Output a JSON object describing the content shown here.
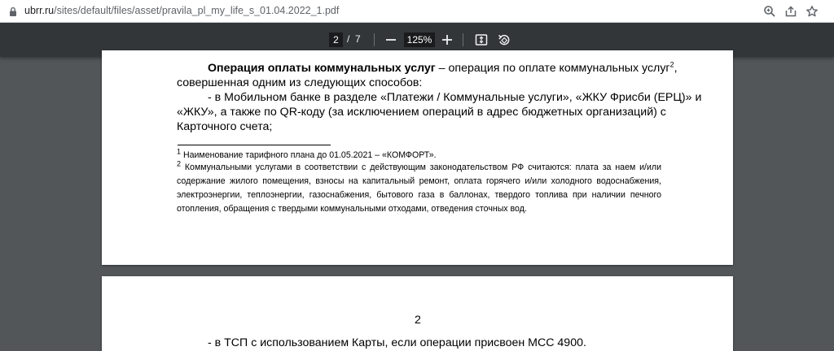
{
  "browser": {
    "url_host": "ubrr.ru",
    "url_path": "/sites/default/files/asset/pravila_pl_my_life_s_01.04.2022_1.pdf"
  },
  "pdf_toolbar": {
    "current_page": "2",
    "separator": "/",
    "total_pages": "7",
    "zoom": "125%"
  },
  "page1": {
    "para1_bold": "Операция оплаты коммунальных услуг",
    "para1_rest": " – операция по оплате коммунальных услуг",
    "para1_sup": "2",
    "para1_end": ",",
    "para1_line2": "совершенная одним из следующих способов:",
    "item1_line1": "- в Мобильном банке в разделе «Платежи / Коммунальные услуги», «ЖКУ Фрисби (ЕРЦ)» и",
    "item1_line2": "«ЖКУ», а также по QR-коду (за исключением операций в адрес бюджетных организаций) с",
    "item1_line3": "Карточного счета;",
    "fn1_mark": "1",
    "fn1_text": " Наименование тарифного плана до 01.05.2021 – «КОМФОРТ».",
    "fn2_mark": "2",
    "fn2_line1": " Коммунальными услугами в соответствии с действующим законодательством РФ считаются: плата за наем и/или",
    "fn2_line2": "содержание жилого помещения, взносы на капитальный ремонт, оплата горячего и/или холодного водоснабжения,",
    "fn2_line3": "электроэнергии, теплоэнергии, газоснабжения, бытового газа в баллонах, твердого топлива при наличии печного",
    "fn2_line4": "отопления, обращения с твердыми коммунальными отходами, отведения сточных вод."
  },
  "page2": {
    "page_number": "2",
    "line1": "- в ТСП с использованием Карты, если операции присвоен МСС 4900."
  },
  "icons": {
    "lock": "lock-icon",
    "zoom": "zoom-icon",
    "share": "share-icon",
    "bookmark": "star-icon",
    "zoom_out": "minus-icon",
    "zoom_in": "plus-icon",
    "fit": "fit-page-icon",
    "rotate": "rotate-icon"
  }
}
